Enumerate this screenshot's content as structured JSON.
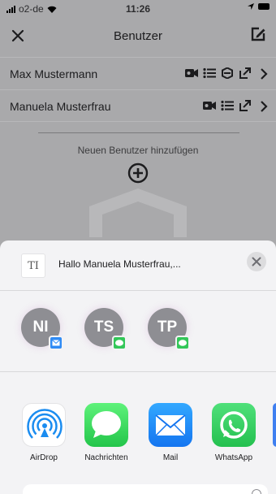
{
  "status_bar": {
    "carrier": "o2-de",
    "time": "11:26"
  },
  "header": {
    "title": "Benutzer",
    "close_icon": "close-icon",
    "edit_icon": "edit-icon"
  },
  "users": [
    {
      "name": "Max Mustermann",
      "icons": [
        "camera-icon",
        "list-icon",
        "hexagon-icon",
        "share-icon"
      ]
    },
    {
      "name": "Manuela Musterfrau",
      "icons": [
        "camera-icon",
        "list-icon",
        "share-icon"
      ]
    }
  ],
  "add_user": {
    "label": "Neuen Benutzer hinzufügen"
  },
  "share_sheet": {
    "preview_thumb": "TI",
    "preview_text": "Hallo Manuela Musterfrau,...",
    "contacts": [
      {
        "initials": "NI",
        "badge": "mail"
      },
      {
        "initials": "TS",
        "badge": "message"
      },
      {
        "initials": "TP",
        "badge": "message"
      }
    ],
    "apps": [
      {
        "label": "AirDrop",
        "icon": "airdrop-icon"
      },
      {
        "label": "Nachrichten",
        "icon": "messages-icon"
      },
      {
        "label": "Mail",
        "icon": "mail-icon"
      },
      {
        "label": "WhatsApp",
        "icon": "whatsapp-icon"
      }
    ]
  },
  "colors": {
    "background": "#a9a9ab",
    "sheet": "#f3f3f5",
    "mail_blue": "#2f8bf5",
    "message_green": "#33c759"
  }
}
